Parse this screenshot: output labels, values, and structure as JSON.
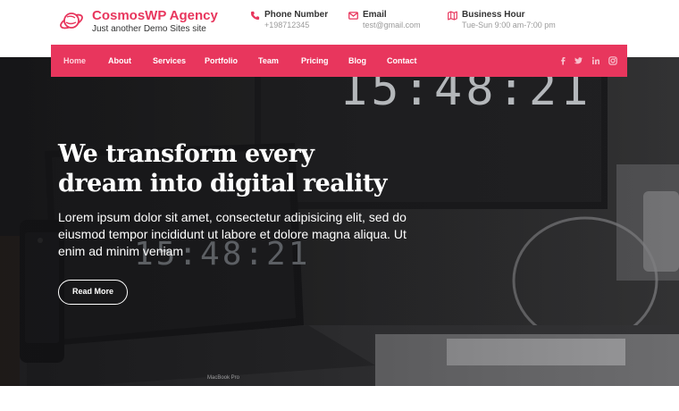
{
  "brand": {
    "title": "CosmosWP Agency",
    "tagline": "Just another Demo Sites site"
  },
  "contact": {
    "phone": {
      "label": "Phone Number",
      "value": "+198712345",
      "icon": "phone-icon"
    },
    "email": {
      "label": "Email",
      "value": "test@gmail.com",
      "icon": "mail-icon"
    },
    "hours": {
      "label": "Business Hour",
      "value": "Tue-Sun 9:00 am-7:00 pm",
      "icon": "map-icon"
    }
  },
  "nav": {
    "items": [
      "Home",
      "About",
      "Services",
      "Portfolio",
      "Team",
      "Pricing",
      "Blog",
      "Contact"
    ],
    "active": "Home",
    "social": [
      "facebook-icon",
      "twitter-icon",
      "linkedin-icon",
      "instagram-icon"
    ]
  },
  "hero": {
    "title_line1": "We transform every",
    "title_line2": "dream into digital reality",
    "text": "Lorem ipsum dolor sit amet, consectetur adipisicing elit, sed do eiusmod tempor incididunt ut labore et dolore magna aliqua. Ut enim ad minim veniam",
    "button": "Read More",
    "clock_big": "15:48:21",
    "clock_small": "15:48:21",
    "laptop_label": "MacBook Pro"
  },
  "colors": {
    "accent": "#e8365d",
    "text_dark": "#333333",
    "text_muted": "#9a9a9a"
  }
}
